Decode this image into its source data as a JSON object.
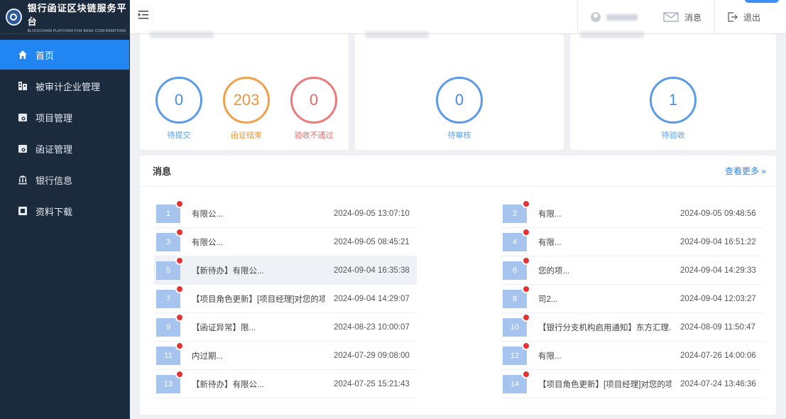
{
  "logo": {
    "title": "银行函证区块链服务平台",
    "subtitle": "BLOCKCHAIN PLATFORM FOR BANK CONFIRMATIONS"
  },
  "sidebar": {
    "items": [
      {
        "label": "首页",
        "icon": "home-icon"
      },
      {
        "label": "被审计企业管理",
        "icon": "building-icon"
      },
      {
        "label": "项目管理",
        "icon": "folder-icon"
      },
      {
        "label": "函证管理",
        "icon": "folder-icon"
      },
      {
        "label": "银行信息",
        "icon": "bank-icon"
      },
      {
        "label": "资料下载",
        "icon": "download-icon"
      }
    ]
  },
  "header": {
    "messages_label": "消息",
    "logout_label": "退出"
  },
  "cards": [
    {
      "stats": [
        {
          "value": "0",
          "label": "待提交"
        },
        {
          "value": "203",
          "label": "函证结束"
        },
        {
          "value": "0",
          "label": "验收不通过"
        }
      ]
    },
    {
      "stats": [
        {
          "value": "0",
          "label": "待审核"
        }
      ]
    },
    {
      "stats": [
        {
          "value": "1",
          "label": "待验收"
        }
      ]
    }
  ],
  "messages": {
    "title": "消息",
    "more_label": "查看更多 »",
    "left": [
      {
        "num": "1",
        "text": "有限公...",
        "time": "2024-09-05 13:07:10"
      },
      {
        "num": "3",
        "text": "有限公...",
        "time": "2024-09-05 08:45:21"
      },
      {
        "num": "5",
        "text": "【新待办】有限公...",
        "time": "2024-09-04 16:35:38"
      },
      {
        "num": "7",
        "text": "【项目角色更新】[项目经理]对您的项...",
        "time": "2024-09-04 14:29:07"
      },
      {
        "num": "9",
        "text": "【函证异常】限...",
        "time": "2024-08-23 10:00:07"
      },
      {
        "num": "11",
        "text": "内过期...",
        "time": "2024-07-29 09:08:00"
      },
      {
        "num": "13",
        "text": "【新待办】有限公...",
        "time": "2024-07-25 15:21:43"
      }
    ],
    "right": [
      {
        "num": "2",
        "text": "有限...",
        "time": "2024-09-05 09:48:56"
      },
      {
        "num": "4",
        "text": "有限...",
        "time": "2024-09-04 16:51:22"
      },
      {
        "num": "6",
        "text": "您的项...",
        "time": "2024-09-04 14:29:33"
      },
      {
        "num": "8",
        "text": "司2...",
        "time": "2024-09-04 12:03:27"
      },
      {
        "num": "10",
        "text": "【银行分支机构启用通知】东方汇理...",
        "time": "2024-08-09 11:50:47"
      },
      {
        "num": "12",
        "text": "有限...",
        "time": "2024-07-26 14:00:06"
      },
      {
        "num": "14",
        "text": "【项目角色更新】[项目经理]对您的项...",
        "time": "2024-07-24 13:46:36"
      }
    ]
  },
  "colors": {
    "sidebar_bg": "#1c2a3e",
    "active": "#2186f2",
    "blue": "#4a8fe4",
    "orange": "#ee9540",
    "red": "#e66a6a",
    "badge": "#a7c4ef"
  }
}
